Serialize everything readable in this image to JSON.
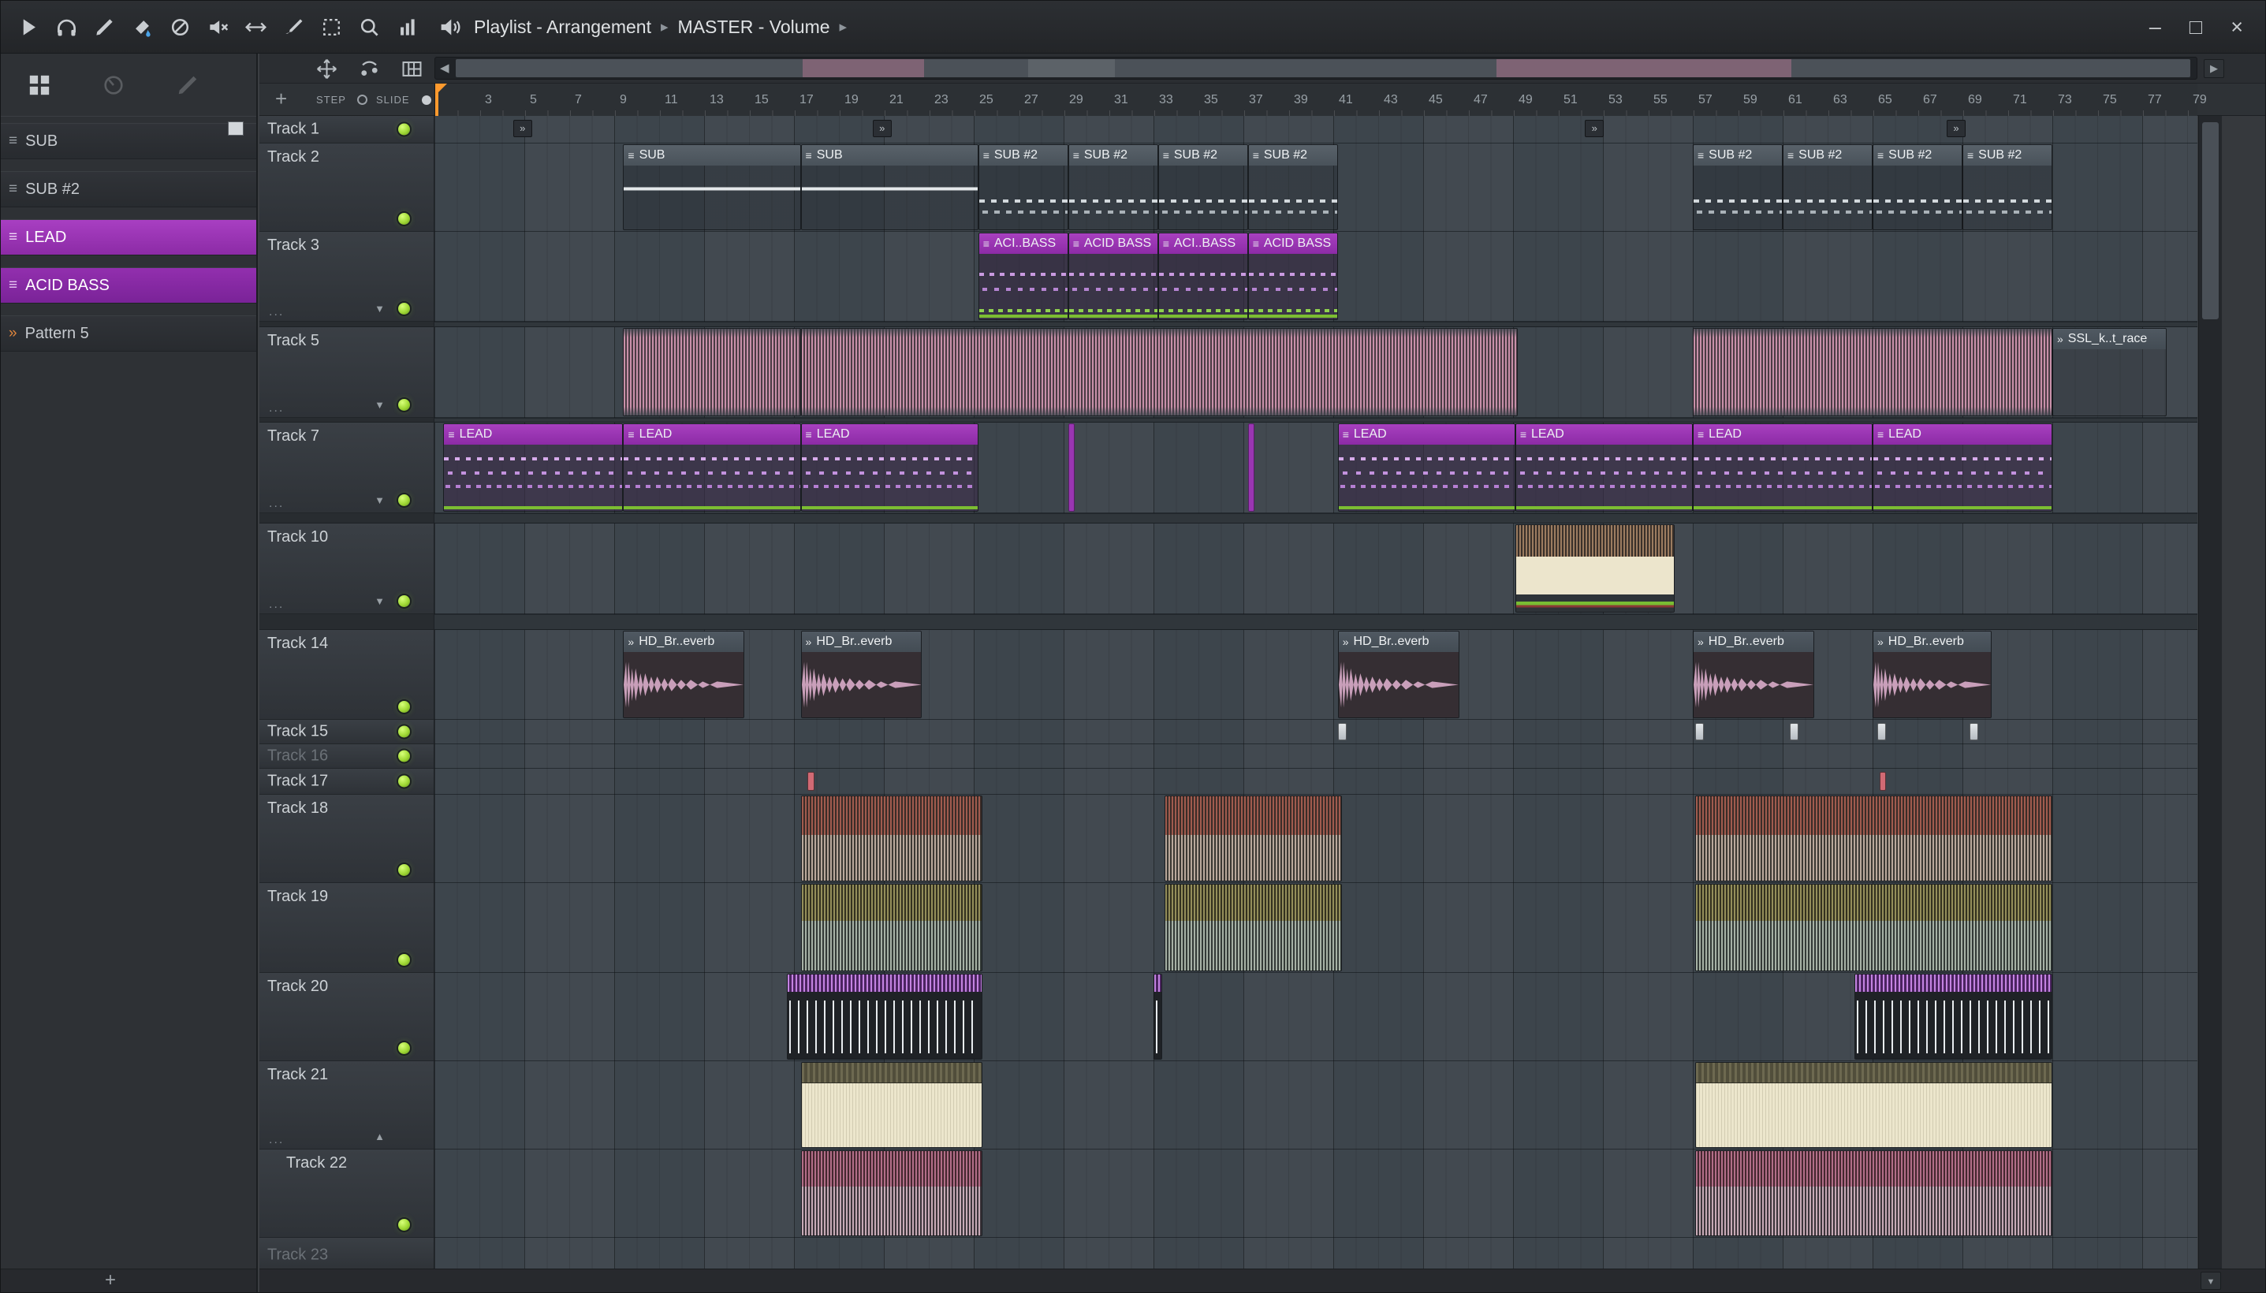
{
  "titlebar": {
    "icons": [
      "play",
      "headphones",
      "draw",
      "paint",
      "slash",
      "mute",
      "panner",
      "brush",
      "select",
      "zoom",
      "meter"
    ],
    "playlist_icon": "speaker",
    "section": "Playlist - Arrangement",
    "separator": "▸",
    "subsection": "MASTER - Volume",
    "window_controls": [
      {
        "name": "minimize",
        "glyph": "–"
      },
      {
        "name": "maximize",
        "glyph": "□"
      },
      {
        "name": "close",
        "glyph": "×"
      }
    ]
  },
  "sidebar": {
    "header_icons": [
      "pattern-grid",
      "knob",
      "pencil"
    ],
    "items": [
      {
        "label": "SUB",
        "icon": "pattern",
        "style": "normal"
      },
      {
        "label": "SUB #2",
        "icon": "pattern",
        "style": "normal"
      },
      {
        "label": "LEAD",
        "icon": "pattern",
        "style": "selected"
      },
      {
        "label": "ACID BASS",
        "icon": "pattern",
        "style": "selected2"
      },
      {
        "label": "Pattern 5",
        "icon": "audio",
        "style": "normal"
      }
    ],
    "add_button": "+"
  },
  "playlist": {
    "toolbar_icons": [
      "pan",
      "slide",
      "piano-roll"
    ],
    "add_button": "+",
    "step_label": "STEP",
    "slide_label": "SLIDE",
    "ruler_numbers": [
      3,
      5,
      7,
      9,
      11,
      13,
      15,
      17,
      19,
      21,
      23,
      25,
      27,
      29,
      31,
      33,
      35,
      37,
      39,
      41,
      43,
      45,
      47,
      49,
      51,
      53,
      55,
      57,
      59,
      61,
      63,
      65,
      67,
      69,
      71,
      73,
      75,
      77,
      79
    ],
    "markers": [
      4.5,
      20.5,
      52.2,
      68.3
    ],
    "tracks": [
      {
        "name": "Track 1",
        "h": 35,
        "led": true
      },
      {
        "name": "Track 2",
        "h": 112,
        "led": true
      },
      {
        "name": "Track 3",
        "h": 114,
        "led": true,
        "ellipsis": true,
        "arrow": "down"
      },
      {
        "spacer": true,
        "h": 7
      },
      {
        "name": "Track 5",
        "h": 115,
        "led": true,
        "ellipsis": true,
        "arrow": "down"
      },
      {
        "spacer": true,
        "h": 6
      },
      {
        "name": "Track 7",
        "h": 115,
        "led": true,
        "ellipsis": true,
        "arrow": "down"
      },
      {
        "spacer": true,
        "h": 13
      },
      {
        "name": "Track 10",
        "h": 115,
        "led": true,
        "ellipsis": true,
        "arrow": "down"
      },
      {
        "spacer": true,
        "h": 20
      },
      {
        "name": "Track 14",
        "h": 114,
        "led": true
      },
      {
        "name": "Track 15",
        "h": 31,
        "led": true
      },
      {
        "name": "Track 16",
        "h": 31,
        "led": true,
        "dim": true
      },
      {
        "name": "Track 17",
        "h": 33,
        "led": true
      },
      {
        "name": "Track 18",
        "h": 112,
        "led": true
      },
      {
        "name": "Track 19",
        "h": 114,
        "led": true
      },
      {
        "name": "Track 20",
        "h": 112,
        "led": true
      },
      {
        "name": "Track 21",
        "h": 112,
        "ellipsis": true,
        "arrow": "up"
      },
      {
        "name": "Track 22",
        "h": 112,
        "led": true,
        "indent": true
      },
      {
        "name": "Track 23",
        "h": 44,
        "dim": true
      }
    ],
    "clips": [
      {
        "track": "Track 2",
        "start": 9.4,
        "end": 17.3,
        "type": "pattern",
        "label": "SUB",
        "header": "gray",
        "body": "sub"
      },
      {
        "track": "Track 2",
        "start": 17.3,
        "end": 25.2,
        "type": "pattern",
        "label": "SUB",
        "header": "gray",
        "body": "sub"
      },
      {
        "track": "Track 2",
        "start": 25.2,
        "end": 29.2,
        "type": "pattern",
        "label": "SUB #2",
        "header": "gray",
        "body": "steps"
      },
      {
        "track": "Track 2",
        "start": 29.2,
        "end": 33.2,
        "type": "pattern",
        "label": "SUB #2",
        "header": "gray",
        "body": "steps"
      },
      {
        "track": "Track 2",
        "start": 33.2,
        "end": 37.2,
        "type": "pattern",
        "label": "SUB #2",
        "header": "gray",
        "body": "steps"
      },
      {
        "track": "Track 2",
        "start": 37.2,
        "end": 41.2,
        "type": "pattern",
        "label": "SUB #2",
        "header": "gray",
        "body": "steps"
      },
      {
        "track": "Track 2",
        "start": 57,
        "end": 61,
        "type": "pattern",
        "label": "SUB #2",
        "header": "gray",
        "body": "steps"
      },
      {
        "track": "Track 2",
        "start": 61,
        "end": 65,
        "type": "pattern",
        "label": "SUB #2",
        "header": "gray",
        "body": "steps"
      },
      {
        "track": "Track 2",
        "start": 65,
        "end": 69,
        "type": "pattern",
        "label": "SUB #2",
        "header": "gray",
        "body": "steps"
      },
      {
        "track": "Track 2",
        "start": 69,
        "end": 73,
        "type": "pattern",
        "label": "SUB #2",
        "header": "gray",
        "body": "steps"
      },
      {
        "track": "Track 3",
        "start": 25.2,
        "end": 29.2,
        "type": "pattern",
        "label": "ACI..BASS",
        "header": "purple",
        "body": "acid"
      },
      {
        "track": "Track 3",
        "start": 29.2,
        "end": 33.2,
        "type": "pattern",
        "label": "ACID BASS",
        "header": "purple",
        "body": "acid"
      },
      {
        "track": "Track 3",
        "start": 33.2,
        "end": 37.2,
        "type": "pattern",
        "label": "ACI..BASS",
        "header": "purple",
        "body": "acid"
      },
      {
        "track": "Track 3",
        "start": 37.2,
        "end": 41.2,
        "type": "pattern",
        "label": "ACID BASS",
        "header": "purple",
        "body": "acid"
      },
      {
        "track": "Track 5",
        "start": 9.4,
        "end": 17.3,
        "type": "wave",
        "variant": "w5"
      },
      {
        "track": "Track 5",
        "start": 17.3,
        "end": 49.2,
        "type": "wave",
        "variant": "w5"
      },
      {
        "track": "Track 5",
        "start": 57,
        "end": 73,
        "type": "wave",
        "variant": "w5"
      },
      {
        "track": "Track 5",
        "start": 73,
        "end": 78.1,
        "type": "audio",
        "label": "SSL_k..t_race",
        "header": "audio",
        "body": "faint"
      },
      {
        "track": "Track 7",
        "start": 1.4,
        "end": 9.4,
        "type": "pattern",
        "label": "LEAD",
        "header": "purple",
        "body": "lead"
      },
      {
        "track": "Track 7",
        "start": 9.4,
        "end": 17.3,
        "type": "pattern",
        "label": "LEAD",
        "header": "purple",
        "body": "lead"
      },
      {
        "track": "Track 7",
        "start": 17.3,
        "end": 25.2,
        "type": "pattern",
        "label": "LEAD",
        "header": "purple",
        "body": "lead"
      },
      {
        "track": "Track 7",
        "start": 29.2,
        "end": 29.5,
        "type": "sliver",
        "variant": "purple"
      },
      {
        "track": "Track 7",
        "start": 37.2,
        "end": 37.5,
        "type": "sliver",
        "variant": "purple"
      },
      {
        "track": "Track 7",
        "start": 41.2,
        "end": 49.1,
        "type": "pattern",
        "label": "LEAD",
        "header": "purple",
        "body": "lead"
      },
      {
        "track": "Track 7",
        "start": 49.1,
        "end": 57,
        "type": "pattern",
        "label": "LEAD",
        "header": "purple",
        "body": "lead"
      },
      {
        "track": "Track 7",
        "start": 57,
        "end": 65,
        "type": "pattern",
        "label": "LEAD",
        "header": "purple",
        "body": "lead"
      },
      {
        "track": "Track 7",
        "start": 65,
        "end": 73,
        "type": "pattern",
        "label": "LEAD",
        "header": "purple",
        "body": "lead"
      },
      {
        "track": "Track 10",
        "start": 49.1,
        "end": 56.2,
        "type": "wave",
        "variant": "stack10"
      },
      {
        "track": "Track 14",
        "start": 9.4,
        "end": 14.8,
        "type": "reverb",
        "label": "HD_Br..everb",
        "header": "audio"
      },
      {
        "track": "Track 14",
        "start": 17.3,
        "end": 22.7,
        "type": "reverb",
        "label": "HD_Br..everb",
        "header": "audio"
      },
      {
        "track": "Track 14",
        "start": 41.2,
        "end": 46.6,
        "type": "reverb",
        "label": "HD_Br..everb",
        "header": "audio"
      },
      {
        "track": "Track 14",
        "start": 57,
        "end": 62.4,
        "type": "reverb",
        "label": "HD_Br..everb",
        "header": "audio"
      },
      {
        "track": "Track 14",
        "start": 65,
        "end": 70.3,
        "type": "reverb",
        "label": "HD_Br..everb",
        "header": "audio"
      },
      {
        "track": "Track 15",
        "start": 41.2,
        "end": 41.6,
        "type": "sliver",
        "variant": "gray"
      },
      {
        "track": "Track 15",
        "start": 57.1,
        "end": 57.5,
        "type": "sliver",
        "variant": "gray"
      },
      {
        "track": "Track 15",
        "start": 61.3,
        "end": 61.7,
        "type": "sliver",
        "variant": "gray"
      },
      {
        "track": "Track 15",
        "start": 65.2,
        "end": 65.6,
        "type": "sliver",
        "variant": "gray"
      },
      {
        "track": "Track 15",
        "start": 69.3,
        "end": 69.7,
        "type": "sliver",
        "variant": "gray"
      },
      {
        "track": "Track 17",
        "start": 17.6,
        "end": 17.9,
        "type": "sliver",
        "variant": "red"
      },
      {
        "track": "Track 17",
        "start": 65.3,
        "end": 65.6,
        "type": "sliver",
        "variant": "red"
      },
      {
        "track": "Track 18",
        "start": 17.3,
        "end": 25.4,
        "type": "wave",
        "variant": "w18"
      },
      {
        "track": "Track 18",
        "start": 33.5,
        "end": 41.4,
        "type": "wave",
        "variant": "w18"
      },
      {
        "track": "Track 18",
        "start": 57.1,
        "end": 73,
        "type": "wave",
        "variant": "w18"
      },
      {
        "track": "Track 19",
        "start": 17.3,
        "end": 25.4,
        "type": "wave",
        "variant": "w19"
      },
      {
        "track": "Track 19",
        "start": 33.5,
        "end": 41.4,
        "type": "wave",
        "variant": "w19"
      },
      {
        "track": "Track 19",
        "start": 57.1,
        "end": 73,
        "type": "wave",
        "variant": "w19"
      },
      {
        "track": "Track 20",
        "start": 16.7,
        "end": 25.4,
        "type": "wave",
        "variant": "drums"
      },
      {
        "track": "Track 20",
        "start": 33,
        "end": 33.4,
        "type": "wave",
        "variant": "drums"
      },
      {
        "track": "Track 20",
        "start": 64.2,
        "end": 73,
        "type": "wave",
        "variant": "drums"
      },
      {
        "track": "Track 21",
        "start": 17.3,
        "end": 25.4,
        "type": "wave",
        "variant": "cream"
      },
      {
        "track": "Track 21",
        "start": 57.1,
        "end": 73,
        "type": "wave",
        "variant": "cream"
      },
      {
        "track": "Track 22",
        "start": 17.3,
        "end": 25.4,
        "type": "wave",
        "variant": "w22"
      },
      {
        "track": "Track 22",
        "start": 57.1,
        "end": 73,
        "type": "wave",
        "variant": "w22"
      }
    ]
  },
  "colors": {
    "accent_purple": "#9633ae",
    "led_green": "#9fe22f",
    "playhead_orange": "#ff9a2e",
    "wave_pink": "#c890a9"
  }
}
